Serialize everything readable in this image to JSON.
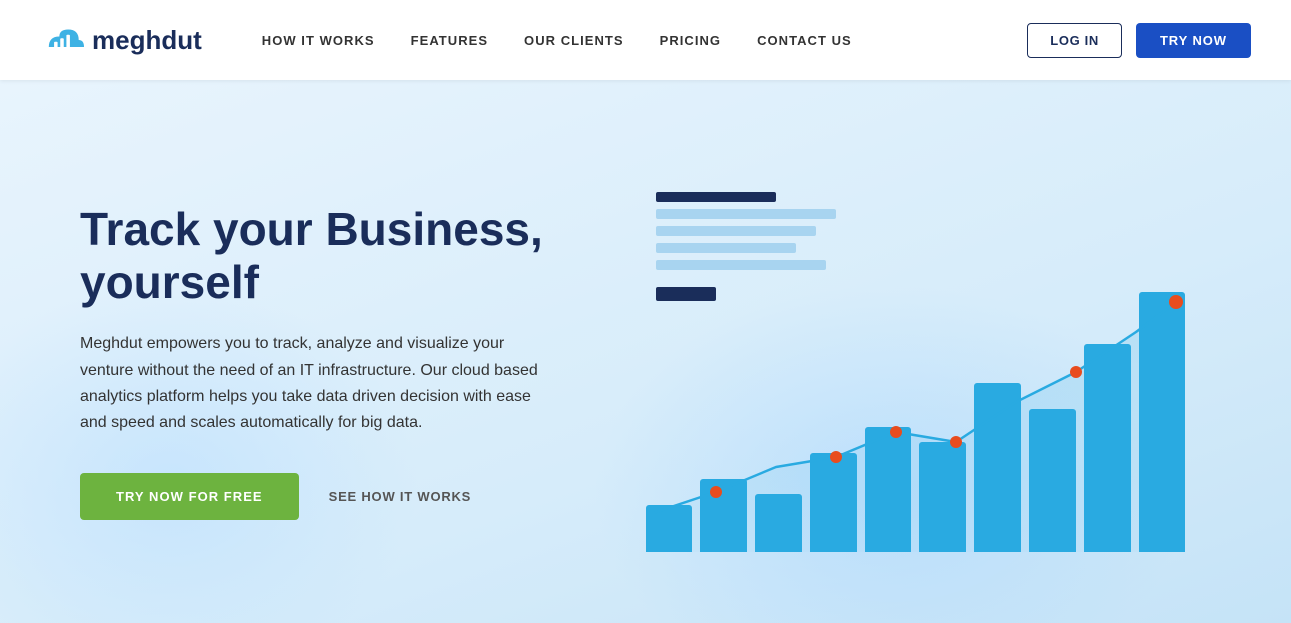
{
  "brand": {
    "name": "meghdut",
    "logo_alt": "meghdut logo"
  },
  "nav": {
    "links": [
      {
        "label": "HOW IT WORKS",
        "id": "how-it-works"
      },
      {
        "label": "FEATURES",
        "id": "features"
      },
      {
        "label": "OUR CLIENTS",
        "id": "our-clients"
      },
      {
        "label": "PRICING",
        "id": "pricing"
      },
      {
        "label": "CONTACT US",
        "id": "contact-us"
      }
    ],
    "login_label": "LOG IN",
    "try_label": "TRY NOW"
  },
  "hero": {
    "title_line1": "Track your Business,",
    "title_line2": "yourself",
    "description": "Meghdut empowers you to track, analyze and visualize your venture without the need of an IT infrastructure. Our cloud based analytics platform helps you take data driven decision with ease and speed and scales automatically for big data.",
    "cta_primary": "TRY NOW FOR FREE",
    "cta_secondary": "SEE HOW IT WORKS"
  },
  "chart": {
    "bars": [
      18,
      28,
      22,
      38,
      48,
      42,
      65,
      55,
      78,
      100
    ],
    "accent_color": "#29aae1",
    "line_color": "#29aae1",
    "dot_color": "#e84c1e"
  },
  "colors": {
    "brand_dark": "#1a2d5a",
    "brand_blue": "#1a4fc4",
    "green": "#6db33f",
    "light_blue": "#29aae1"
  }
}
